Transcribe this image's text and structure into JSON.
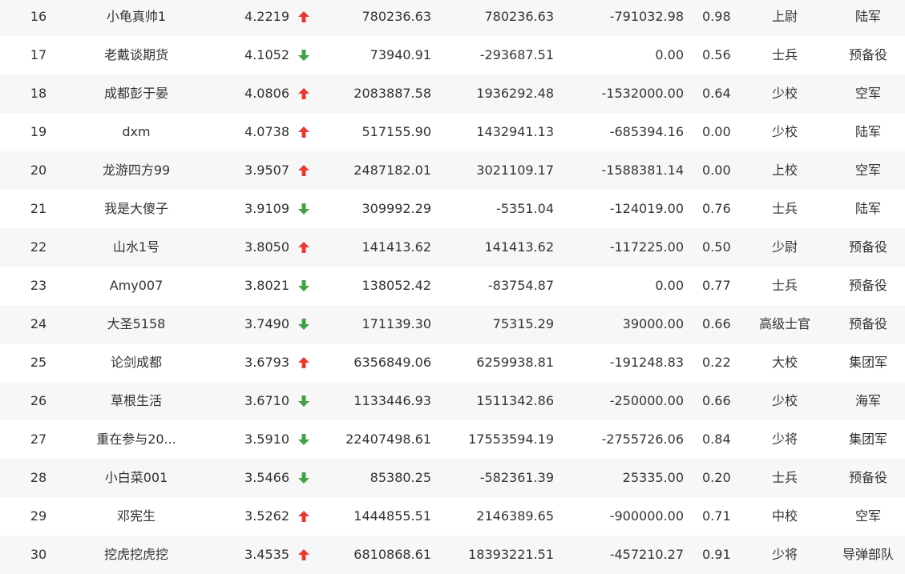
{
  "colors": {
    "up": "#e53935",
    "down": "#43a047",
    "row_alt": "#f7f7f7"
  },
  "rows": [
    {
      "rank": "16",
      "name": "小龟真帅1",
      "score": "4.2219",
      "trend": "up",
      "v1": "780236.63",
      "v2": "780236.63",
      "v3": "-791032.98",
      "ratio": "0.98",
      "title": "上尉",
      "branch": "陆军"
    },
    {
      "rank": "17",
      "name": "老戴谈期货",
      "score": "4.1052",
      "trend": "down",
      "v1": "73940.91",
      "v2": "-293687.51",
      "v3": "0.00",
      "ratio": "0.56",
      "title": "士兵",
      "branch": "预备役"
    },
    {
      "rank": "18",
      "name": "成都彭于晏",
      "score": "4.0806",
      "trend": "up",
      "v1": "2083887.58",
      "v2": "1936292.48",
      "v3": "-1532000.00",
      "ratio": "0.64",
      "title": "少校",
      "branch": "空军"
    },
    {
      "rank": "19",
      "name": "dxm",
      "score": "4.0738",
      "trend": "up",
      "v1": "517155.90",
      "v2": "1432941.13",
      "v3": "-685394.16",
      "ratio": "0.00",
      "title": "少校",
      "branch": "陆军"
    },
    {
      "rank": "20",
      "name": "龙游四方99",
      "score": "3.9507",
      "trend": "up",
      "v1": "2487182.01",
      "v2": "3021109.17",
      "v3": "-1588381.14",
      "ratio": "0.00",
      "title": "上校",
      "branch": "空军"
    },
    {
      "rank": "21",
      "name": "我是大傻子",
      "score": "3.9109",
      "trend": "down",
      "v1": "309992.29",
      "v2": "-5351.04",
      "v3": "-124019.00",
      "ratio": "0.76",
      "title": "士兵",
      "branch": "陆军"
    },
    {
      "rank": "22",
      "name": "山水1号",
      "score": "3.8050",
      "trend": "up",
      "v1": "141413.62",
      "v2": "141413.62",
      "v3": "-117225.00",
      "ratio": "0.50",
      "title": "少尉",
      "branch": "预备役"
    },
    {
      "rank": "23",
      "name": "Amy007",
      "score": "3.8021",
      "trend": "down",
      "v1": "138052.42",
      "v2": "-83754.87",
      "v3": "0.00",
      "ratio": "0.77",
      "title": "士兵",
      "branch": "预备役"
    },
    {
      "rank": "24",
      "name": "大圣5158",
      "score": "3.7490",
      "trend": "down",
      "v1": "171139.30",
      "v2": "75315.29",
      "v3": "39000.00",
      "ratio": "0.66",
      "title": "高级士官",
      "branch": "预备役"
    },
    {
      "rank": "25",
      "name": "论剑成都",
      "score": "3.6793",
      "trend": "up",
      "v1": "6356849.06",
      "v2": "6259938.81",
      "v3": "-191248.83",
      "ratio": "0.22",
      "title": "大校",
      "branch": "集团军"
    },
    {
      "rank": "26",
      "name": "草根生活",
      "score": "3.6710",
      "trend": "down",
      "v1": "1133446.93",
      "v2": "1511342.86",
      "v3": "-250000.00",
      "ratio": "0.66",
      "title": "少校",
      "branch": "海军"
    },
    {
      "rank": "27",
      "name": "重在参与20...",
      "score": "3.5910",
      "trend": "down",
      "v1": "22407498.61",
      "v2": "17553594.19",
      "v3": "-2755726.06",
      "ratio": "0.84",
      "title": "少将",
      "branch": "集团军"
    },
    {
      "rank": "28",
      "name": "小白菜001",
      "score": "3.5466",
      "trend": "down",
      "v1": "85380.25",
      "v2": "-582361.39",
      "v3": "25335.00",
      "ratio": "0.20",
      "title": "士兵",
      "branch": "预备役"
    },
    {
      "rank": "29",
      "name": "邓宪生",
      "score": "3.5262",
      "trend": "up",
      "v1": "1444855.51",
      "v2": "2146389.65",
      "v3": "-900000.00",
      "ratio": "0.71",
      "title": "中校",
      "branch": "空军"
    },
    {
      "rank": "30",
      "name": "挖虎挖虎挖",
      "score": "3.4535",
      "trend": "up",
      "v1": "6810868.61",
      "v2": "18393221.51",
      "v3": "-457210.27",
      "ratio": "0.91",
      "title": "少将",
      "branch": "导弹部队"
    }
  ]
}
